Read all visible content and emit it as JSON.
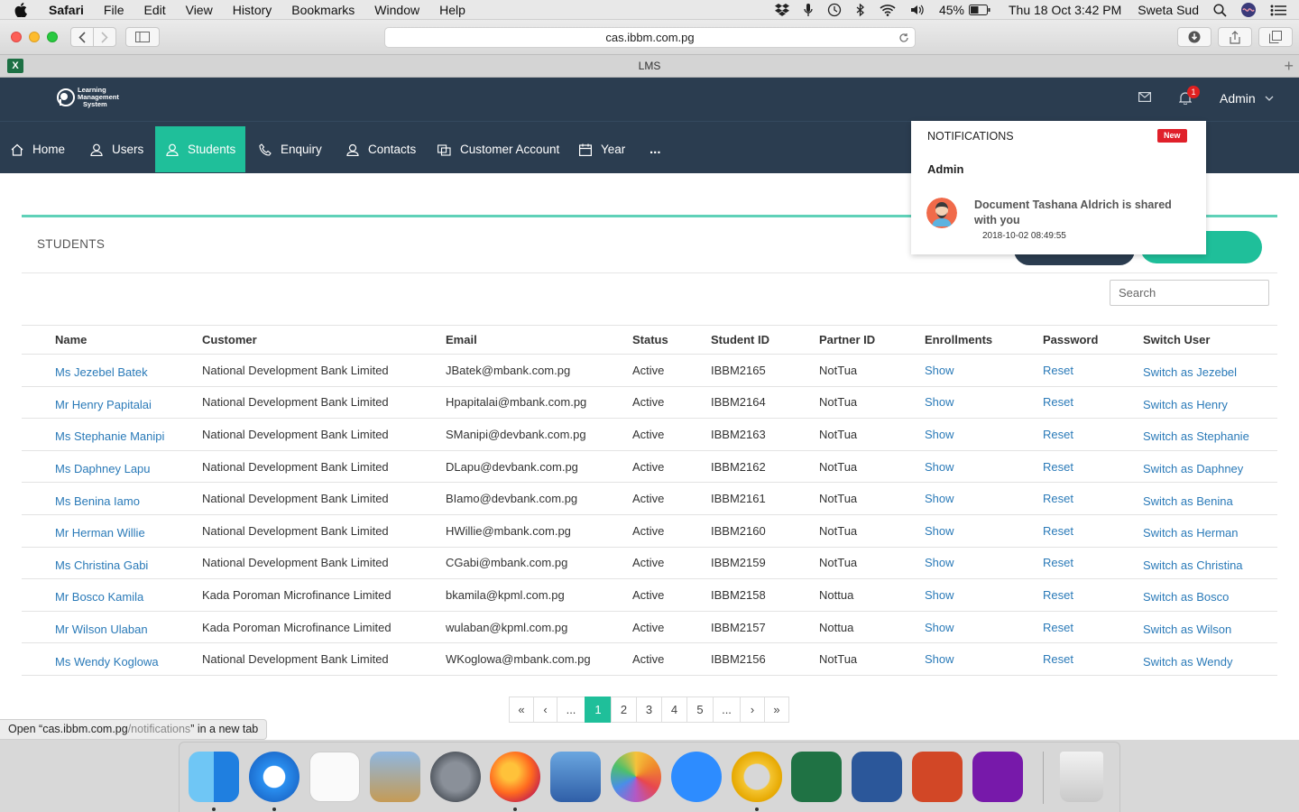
{
  "menubar": {
    "app": "Safari",
    "items": [
      "File",
      "Edit",
      "View",
      "History",
      "Bookmarks",
      "Window",
      "Help"
    ],
    "battery": "45%",
    "datetime": "Thu 18 Oct  3:42 PM",
    "user": "Sweta Sud"
  },
  "browser": {
    "url": "cas.ibbm.com.pg",
    "tab_title": "LMS",
    "status_prefix": "Open “",
    "status_link": "cas.ibbm.com.pg",
    "status_path": "/notifications",
    "status_suffix": "” in a new tab"
  },
  "header": {
    "logo_line1": "Learning",
    "logo_line2": "Management",
    "logo_line3": "System",
    "notification_count": "1",
    "user": "Admin"
  },
  "nav": {
    "items": [
      {
        "label": "Home",
        "icon": "home-icon"
      },
      {
        "label": "Users",
        "icon": "user-icon"
      },
      {
        "label": "Students",
        "icon": "student-icon",
        "active": true
      },
      {
        "label": "Enquiry",
        "icon": "phone-icon"
      },
      {
        "label": "Contacts",
        "icon": "contacts-icon"
      },
      {
        "label": "Customer Account",
        "icon": "account-icon"
      },
      {
        "label": "Year",
        "icon": "calendar-icon"
      }
    ],
    "more": "..."
  },
  "page": {
    "title": "STUDENTS",
    "green_button_fragment": "d",
    "search_placeholder": "Search"
  },
  "table": {
    "columns": [
      "Name",
      "Customer",
      "Email",
      "Status",
      "Student ID",
      "Partner ID",
      "Enrollments",
      "Password",
      "Switch User"
    ],
    "rows": [
      {
        "name": "Ms Jezebel Batek",
        "customer": "National Development Bank Limited",
        "email": "JBatek@mbank.com.pg",
        "status": "Active",
        "student_id": "IBBM2165",
        "partner_id": "NotTua",
        "enrollments": "Show",
        "password": "Reset",
        "switch": "Switch as Jezebel"
      },
      {
        "name": "Mr Henry Papitalai",
        "customer": "National Development Bank Limited",
        "email": "Hpapitalai@mbank.com.pg",
        "status": "Active",
        "student_id": "IBBM2164",
        "partner_id": "NotTua",
        "enrollments": "Show",
        "password": "Reset",
        "switch": "Switch as Henry"
      },
      {
        "name": "Ms Stephanie Manipi",
        "customer": "National Development Bank Limited",
        "email": "SManipi@devbank.com.pg",
        "status": "Active",
        "student_id": "IBBM2163",
        "partner_id": "NotTua",
        "enrollments": "Show",
        "password": "Reset",
        "switch": "Switch as Stephanie"
      },
      {
        "name": "Ms Daphney Lapu",
        "customer": "National Development Bank Limited",
        "email": "DLapu@devbank.com.pg",
        "status": "Active",
        "student_id": "IBBM2162",
        "partner_id": "NotTua",
        "enrollments": "Show",
        "password": "Reset",
        "switch": "Switch as Daphney"
      },
      {
        "name": "Ms Benina Iamo",
        "customer": "National Development Bank Limited",
        "email": "BIamo@devbank.com.pg",
        "status": "Active",
        "student_id": "IBBM2161",
        "partner_id": "NotTua",
        "enrollments": "Show",
        "password": "Reset",
        "switch": "Switch as Benina"
      },
      {
        "name": "Mr Herman Willie",
        "customer": "National Development Bank Limited",
        "email": "HWillie@mbank.com.pg",
        "status": "Active",
        "student_id": "IBBM2160",
        "partner_id": "NotTua",
        "enrollments": "Show",
        "password": "Reset",
        "switch": "Switch as Herman"
      },
      {
        "name": "Ms Christina Gabi",
        "customer": "National Development Bank Limited",
        "email": "CGabi@mbank.com.pg",
        "status": "Active",
        "student_id": "IBBM2159",
        "partner_id": "NotTua",
        "enrollments": "Show",
        "password": "Reset",
        "switch": "Switch as Christina"
      },
      {
        "name": "Mr Bosco Kamila",
        "customer": "Kada Poroman Microfinance Limited",
        "email": "bkamila@kpml.com.pg",
        "status": "Active",
        "student_id": "IBBM2158",
        "partner_id": "Nottua",
        "enrollments": "Show",
        "password": "Reset",
        "switch": "Switch as Bosco"
      },
      {
        "name": "Mr Wilson Ulaban",
        "customer": "Kada Poroman Microfinance Limited",
        "email": "wulaban@kpml.com.pg",
        "status": "Active",
        "student_id": "IBBM2157",
        "partner_id": "Nottua",
        "enrollments": "Show",
        "password": "Reset",
        "switch": "Switch as Wilson"
      },
      {
        "name": "Ms Wendy Koglowa",
        "customer": "National Development Bank Limited",
        "email": "WKoglowa@mbank.com.pg",
        "status": "Active",
        "student_id": "IBBM2156",
        "partner_id": "NotTua",
        "enrollments": "Show",
        "password": "Reset",
        "switch": "Switch as Wendy"
      }
    ]
  },
  "pagination": {
    "items": [
      "«",
      "‹",
      "...",
      "1",
      "2",
      "3",
      "4",
      "5",
      "...",
      "›",
      "»"
    ],
    "current": "1"
  },
  "notifications": {
    "title": "NOTIFICATIONS",
    "new_badge": "New",
    "group": "Admin",
    "item_message": "Document Tashana Aldrich is shared with you",
    "item_time": "2018-10-02 08:49:55"
  },
  "colors": {
    "header_bg": "#2b3d50",
    "accent": "#1fbf9a",
    "link": "#2a7ab8",
    "badge": "#e02020"
  },
  "dock": {
    "apps": [
      "finder-icon",
      "safari-icon",
      "reminders-icon",
      "preview-icon",
      "launchpad-icon",
      "firefox-icon",
      "screen-share-icon",
      "photos-icon",
      "zoom-icon",
      "outlook-icon",
      "excel-icon",
      "word-icon",
      "powerpoint-icon",
      "onenote-icon",
      "trash-icon"
    ]
  }
}
